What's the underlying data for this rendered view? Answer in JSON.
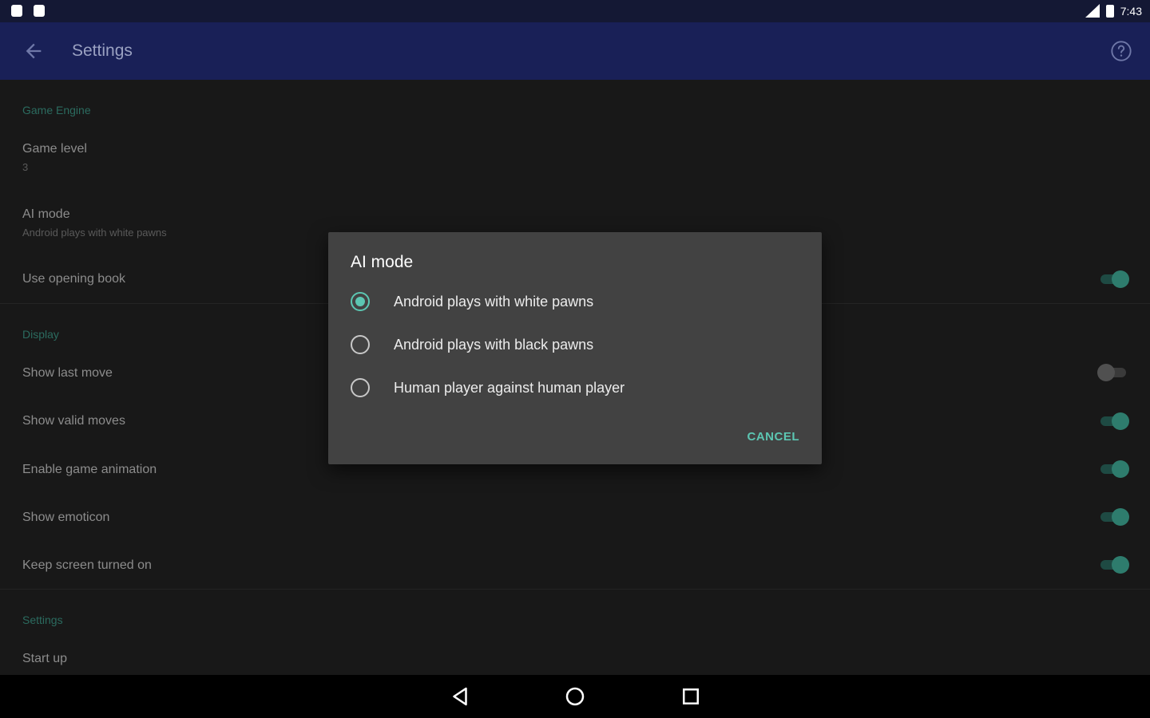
{
  "status_bar": {
    "time": "7:43"
  },
  "app_bar": {
    "title": "Settings",
    "back_icon": "arrow-back-icon",
    "help_icon": "help-circle-icon"
  },
  "settings": {
    "sections": [
      {
        "header": "Game Engine",
        "items": [
          {
            "title": "Game level",
            "summary": "3"
          },
          {
            "title": "AI mode",
            "summary": "Android plays with white pawns"
          },
          {
            "title": "Use opening book",
            "switch": true
          }
        ]
      },
      {
        "header": "Display",
        "items": [
          {
            "title": "Show last move",
            "switch": false
          },
          {
            "title": "Show valid moves",
            "switch": true
          },
          {
            "title": "Enable game animation",
            "switch": true
          },
          {
            "title": "Show emoticon",
            "switch": true
          },
          {
            "title": "Keep screen turned on",
            "switch": true
          }
        ]
      },
      {
        "header": "Settings",
        "items": [
          {
            "title": "Start up"
          }
        ]
      }
    ]
  },
  "dialog": {
    "title": "AI mode",
    "options": [
      {
        "label": "Android plays with white pawns",
        "selected": true
      },
      {
        "label": "Android plays with black pawns",
        "selected": false
      },
      {
        "label": "Human player against human player",
        "selected": false
      }
    ],
    "cancel_label": "CANCEL"
  },
  "colors": {
    "accent": "#5cc6b2",
    "app_bar": "#192057",
    "status_bar": "#141834",
    "dialog_bg": "#424242",
    "content_bg": "#181818"
  },
  "nav_bar": {
    "icons": [
      "back-triangle-icon",
      "home-circle-icon",
      "recents-square-icon"
    ]
  }
}
